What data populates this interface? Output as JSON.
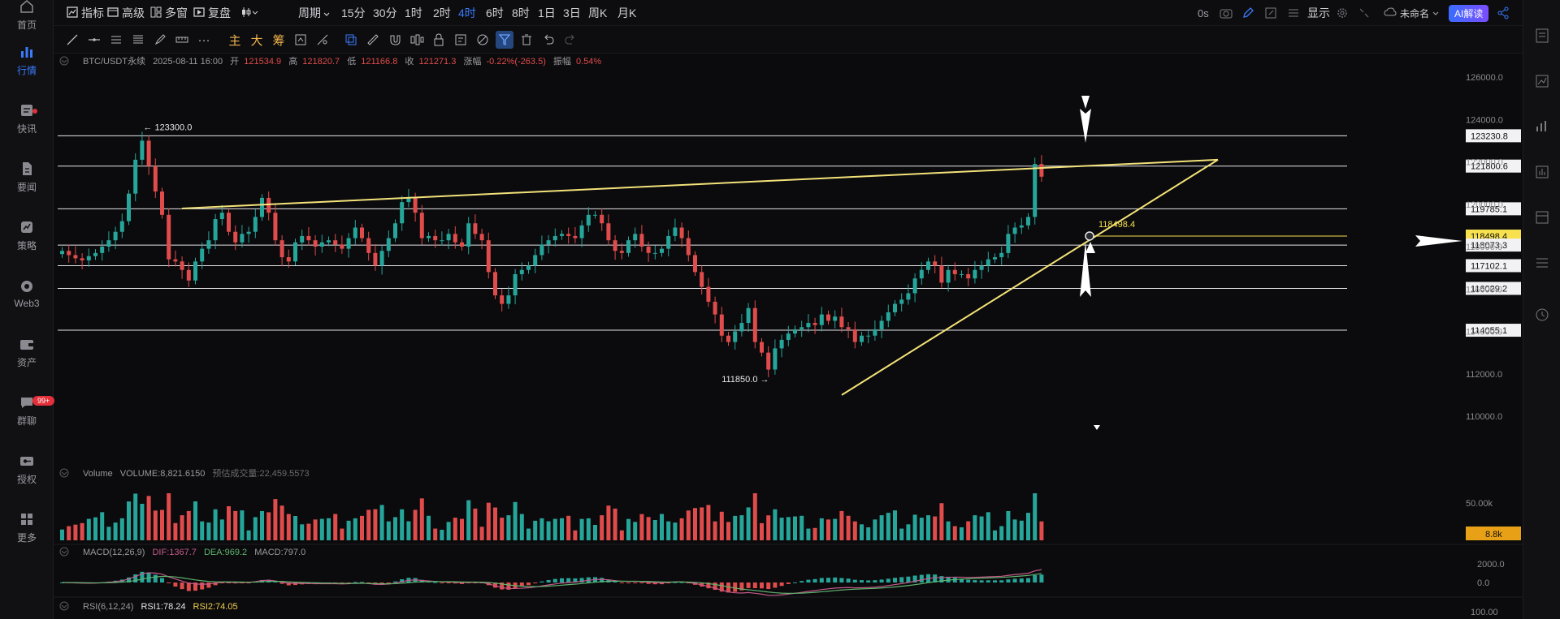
{
  "nav": {
    "items": [
      {
        "label": "首页",
        "icon": "home-icon"
      },
      {
        "label": "行情",
        "icon": "chart-bars-icon"
      },
      {
        "label": "快讯",
        "icon": "news-flash-icon"
      },
      {
        "label": "要闻",
        "icon": "document-icon"
      },
      {
        "label": "策略",
        "icon": "strategy-icon"
      },
      {
        "label": "Web3",
        "icon": "web3-icon"
      },
      {
        "label": "资产",
        "icon": "wallet-icon"
      },
      {
        "label": "群聊",
        "icon": "chat-icon",
        "badge": "99+"
      },
      {
        "label": "授权",
        "icon": "key-icon"
      },
      {
        "label": "更多",
        "icon": "grid-icon"
      }
    ]
  },
  "topbar": {
    "indicators": "指标",
    "advanced": "高级",
    "multi_window": "多窗",
    "replay": "复盘",
    "period": "周期",
    "timeframes": [
      "15分",
      "30分",
      "1时",
      "2时",
      "4时",
      "6时",
      "8时",
      "1日",
      "3日",
      "周K",
      "月K"
    ],
    "active_timeframe": "4时",
    "latency": "0s",
    "display": "显示",
    "layout_name": "未命名",
    "ai_button": "AI解读"
  },
  "drawbar": {
    "text_tools": [
      "主",
      "大",
      "筹"
    ]
  },
  "legend": {
    "symbol": "BTC/USDT永续",
    "datetime": "2025-08-11 16:00",
    "open_label": "开",
    "open": "121534.9",
    "high_label": "高",
    "high": "121820.7",
    "low_label": "低",
    "low": "121166.8",
    "close_label": "收",
    "close": "121271.3",
    "change_label": "涨幅",
    "change": "-0.22%(-263.5)",
    "amp_label": "振幅",
    "amp": "0.54%"
  },
  "volume_legend": {
    "title": "Volume",
    "value": "VOLUME:8,821.6150",
    "forecast": "预估成交量:22,459.5573"
  },
  "macd_legend": {
    "title": "MACD(12,26,9)",
    "dif": "DIF:1367.7",
    "dea": "DEA:969.2",
    "macd": "MACD:797.0"
  },
  "rsi_legend": {
    "title": "RSI(6,12,24)",
    "rsi1": "RSI1:78.24",
    "rsi2": "RSI2:74.05"
  },
  "colors": {
    "up": "#26a69a",
    "down": "#e04b4b",
    "trend": "#f3e27a",
    "accent": "#3a7bfd",
    "tag_price": "#f7e14e",
    "tag_volume": "#e8a016"
  },
  "chart_data": {
    "type": "candlestick",
    "y_axis_ticks": [
      "126000.0",
      "124000.0",
      "122000.0",
      "120000.0",
      "118000.0",
      "116000.0",
      "114000.0",
      "112000.0",
      "110000.0"
    ],
    "ylim": [
      110000,
      126000
    ],
    "horizontal_levels": [
      "123230.8",
      "121800.6",
      "119785.1",
      "118498.4",
      "118073.3",
      "117102.1",
      "116029.2",
      "114055.1"
    ],
    "annotations": {
      "high_label": "123300.0",
      "low_label": "111850.0",
      "intersection_label": "118498.4"
    },
    "volume_axis_ticks": [
      "50.00k"
    ],
    "volume_tag": "8.8k",
    "macd_axis_ticks": [
      "2000.0",
      "0.0"
    ],
    "rsi_axis_ticks": [
      "100.00"
    ],
    "closes": [
      117800,
      117600,
      117450,
      117350,
      117550,
      117700,
      118000,
      118300,
      118700,
      119200,
      120500,
      122100,
      123000,
      121800,
      120600,
      119500,
      117400,
      117300,
      116900,
      116400,
      117300,
      117900,
      118300,
      119300,
      119600,
      118700,
      118200,
      118600,
      118700,
      119400,
      120300,
      119600,
      118300,
      117500,
      117300,
      118200,
      118500,
      118300,
      118000,
      118200,
      118300,
      118100,
      117900,
      118400,
      118900,
      118400,
      117700,
      117100,
      117800,
      118400,
      119100,
      120100,
      120300,
      119600,
      118400,
      118500,
      118300,
      118300,
      118600,
      118200,
      118000,
      119100,
      118600,
      118300,
      116800,
      115700,
      115300,
      115700,
      116700,
      116900,
      117100,
      117600,
      118100,
      118300,
      118500,
      118600,
      118500,
      118400,
      119000,
      119500,
      119500,
      119100,
      118300,
      117800,
      117700,
      118300,
      118600,
      118000,
      117700,
      117700,
      117900,
      118500,
      118900,
      118400,
      117600,
      116800,
      116100,
      115400,
      114800,
      113800,
      113500,
      114000,
      114400,
      115100,
      113500,
      113000,
      112200,
      113200,
      113600,
      113900,
      114100,
      114200,
      114400,
      114300,
      114800,
      114500,
      114700,
      114200,
      114100,
      113500,
      113800,
      113800,
      114100,
      114500,
      114900,
      115300,
      115500,
      115800,
      116500,
      116900,
      117300,
      117100,
      116300,
      116900,
      116700,
      116700,
      116500,
      116900,
      117100,
      117400,
      117500,
      117700,
      118600,
      118900,
      119000,
      119400,
      121900,
      121300
    ]
  }
}
